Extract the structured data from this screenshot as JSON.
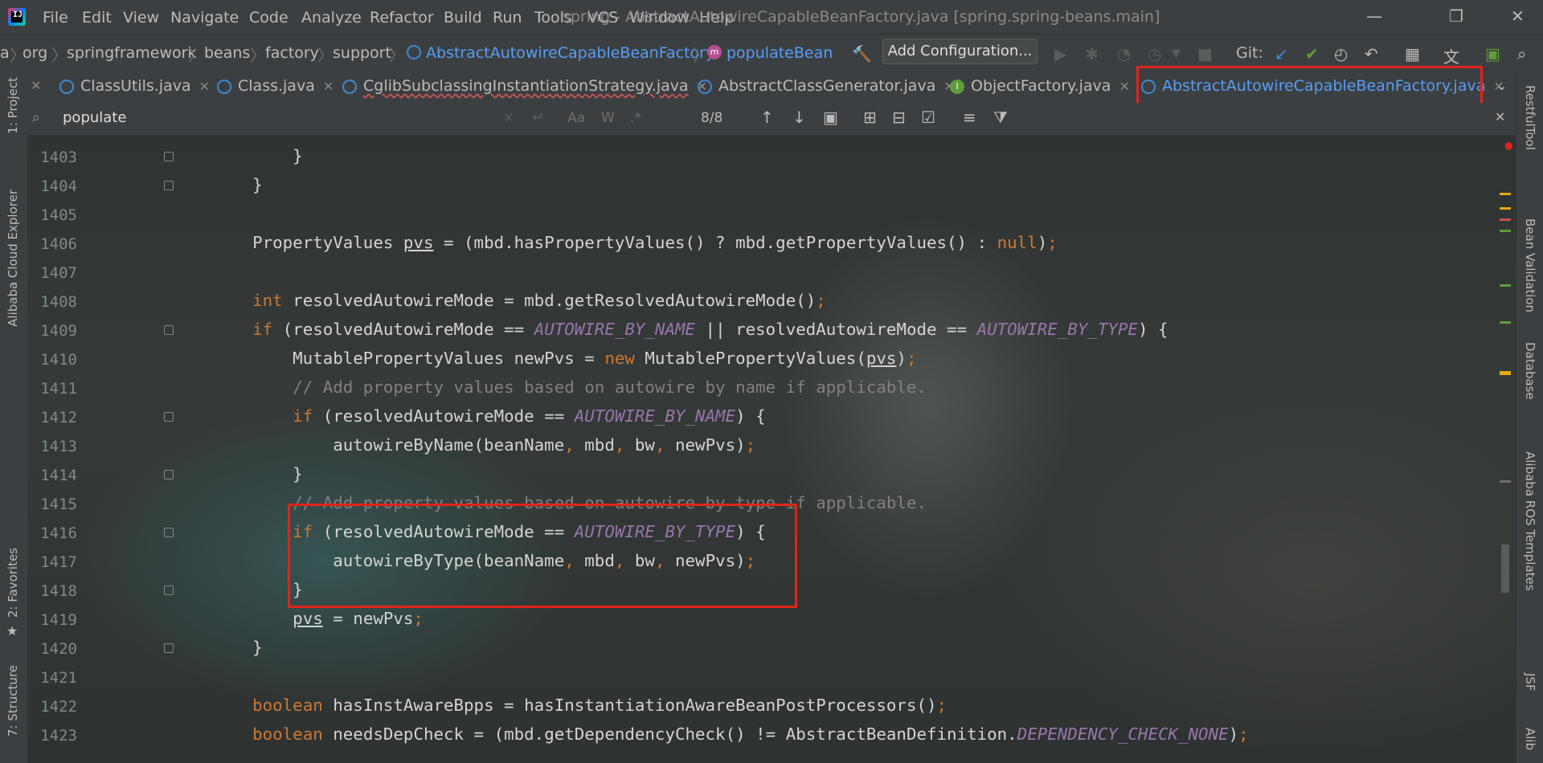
{
  "window": {
    "title": "spring - AbstractAutowireCapableBeanFactory.java [spring.spring-beans.main]",
    "menu": [
      "File",
      "Edit",
      "View",
      "Navigate",
      "Code",
      "Analyze",
      "Refactor",
      "Build",
      "Run",
      "Tools",
      "VCS",
      "Window",
      "Help"
    ],
    "controls": {
      "minimize": "—",
      "maximize": "❐",
      "close": "✕"
    }
  },
  "navbar": {
    "breadcrumbs": [
      "org",
      "springframework",
      "beans",
      "factory",
      "support",
      "AbstractAutowireCapableBeanFactory",
      "populateBean"
    ],
    "method_badge": "m",
    "add_configuration": "Add Configuration...",
    "git_label": "Git:"
  },
  "tabs": [
    {
      "label": "ClassUtils.java",
      "icon": "class-icon",
      "error": false
    },
    {
      "label": "Class.java",
      "icon": "class-icon",
      "error": false
    },
    {
      "label": "CglibSubclassingInstantiationStrategy.java",
      "icon": "class-icon",
      "error": true
    },
    {
      "label": "AbstractClassGenerator.java",
      "icon": "class-icon",
      "error": false
    },
    {
      "label": "ObjectFactory.java",
      "icon": "interface-icon",
      "error": false
    },
    {
      "label": "AbstractAutowireCapableBeanFactory.java",
      "icon": "class-icon",
      "error": false,
      "active": true
    }
  ],
  "interface_badge": "I",
  "search": {
    "query": "populate",
    "match_case": "Aa",
    "words": "W",
    "regex": ".*",
    "match_count": "8/8"
  },
  "left_tools": [
    "1: Project",
    "Alibaba Cloud Explorer",
    "2: Favorites",
    "7: Structure"
  ],
  "right_tools": [
    "RestfulTool",
    "Bean Validation",
    "Database",
    "Alibaba ROS Templates",
    "JSF",
    "Alib"
  ],
  "editor": {
    "line_numbers": [
      "1403",
      "1404",
      "1405",
      "1406",
      "1407",
      "1408",
      "1409",
      "1410",
      "1411",
      "1412",
      "1413",
      "1414",
      "1415",
      "1416",
      "1417",
      "1418",
      "1419",
      "1420",
      "1421",
      "1422",
      "1423"
    ]
  },
  "colors": {
    "highlight_box": "#e0241b",
    "keyword": "#cc7832",
    "constant": "#9876aa",
    "comment": "#808080",
    "active_tab": "#589df6"
  }
}
